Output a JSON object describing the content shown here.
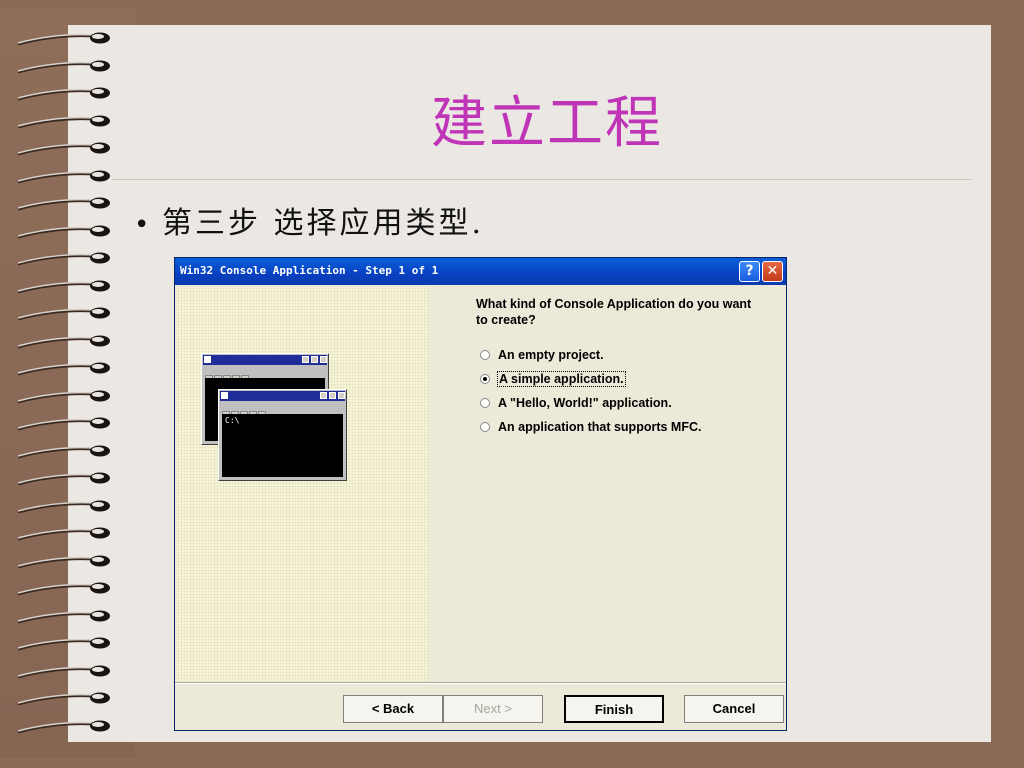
{
  "slide": {
    "title": "建立工程",
    "bullet": "第三步 选择应用类型."
  },
  "dialog": {
    "title": "Win32 Console Application - Step 1 of 1",
    "help_glyph": "?",
    "close_glyph": "✕",
    "question": "What kind of Console Application do you want to create?",
    "options": [
      {
        "label": "An empty project.",
        "selected": false
      },
      {
        "label": "A simple application.",
        "selected": true
      },
      {
        "label": "A \"Hello, World!\" application.",
        "selected": false
      },
      {
        "label": "An application that supports MFC.",
        "selected": false
      }
    ],
    "buttons": {
      "back": "< Back",
      "next": "Next >",
      "finish": "Finish",
      "cancel": "Cancel"
    },
    "preview": {
      "prompt": "C:\\"
    }
  },
  "colors": {
    "background": "#8b6b58",
    "slide": "#ebe7e3",
    "title": "#c034b8",
    "titlebar": "#0a5fd8"
  },
  "icons": [
    "spiral-binder-ring",
    "help-icon",
    "close-icon",
    "radio-button",
    "console-window-icon"
  ]
}
